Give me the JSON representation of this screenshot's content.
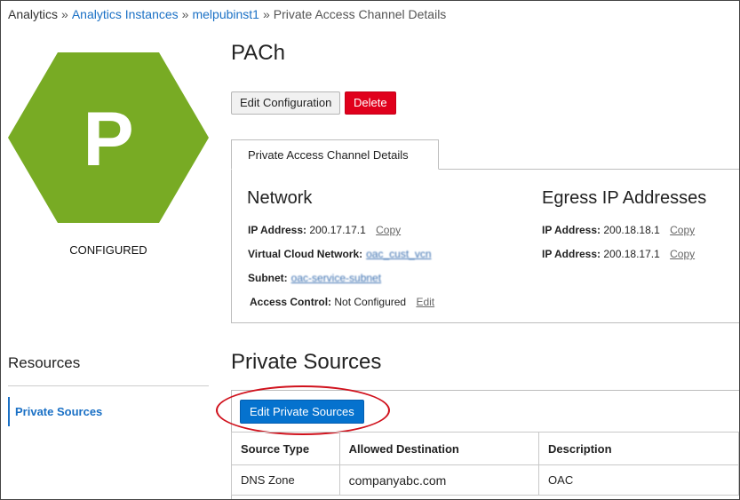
{
  "breadcrumb": {
    "root": "Analytics",
    "separator": "»",
    "items": [
      "Analytics Instances",
      "melpubinst1"
    ],
    "current": "Private Access Channel Details"
  },
  "instance": {
    "letter": "P",
    "status": "CONFIGURED",
    "badge_color": "#78ab24"
  },
  "header": {
    "title": "PACh"
  },
  "actions": {
    "edit_configuration": "Edit Configuration",
    "delete": "Delete"
  },
  "details_tab": {
    "label": "Private Access Channel Details"
  },
  "network": {
    "heading": "Network",
    "ip_label": "IP Address:",
    "ip_value": "200.17.17.1",
    "copy": "Copy",
    "vcn_label": "Virtual Cloud Network:",
    "vcn_value": "oac_cust_vcn",
    "subnet_label": "Subnet:",
    "subnet_value": "oac-service-subnet",
    "access_label": "Access Control:",
    "access_value": "Not Configured",
    "edit": "Edit"
  },
  "egress": {
    "heading": "Egress IP Addresses",
    "entries": [
      {
        "label": "IP Address:",
        "value": "200.18.18.1",
        "copy": "Copy"
      },
      {
        "label": "IP Address:",
        "value": "200.18.17.1",
        "copy": "Copy"
      }
    ]
  },
  "resources": {
    "title": "Resources",
    "items": [
      "Private Sources"
    ]
  },
  "private_sources": {
    "title": "Private Sources",
    "edit_button": "Edit Private Sources",
    "columns": [
      "Source Type",
      "Allowed Destination",
      "Description"
    ],
    "rows": [
      [
        "DNS Zone",
        "companyabc.com",
        "OAC"
      ]
    ]
  },
  "colors": {
    "link": "#1a70c5",
    "delete": "#e0001c",
    "primary": "#0572ce",
    "annotation": "#d0111c"
  }
}
